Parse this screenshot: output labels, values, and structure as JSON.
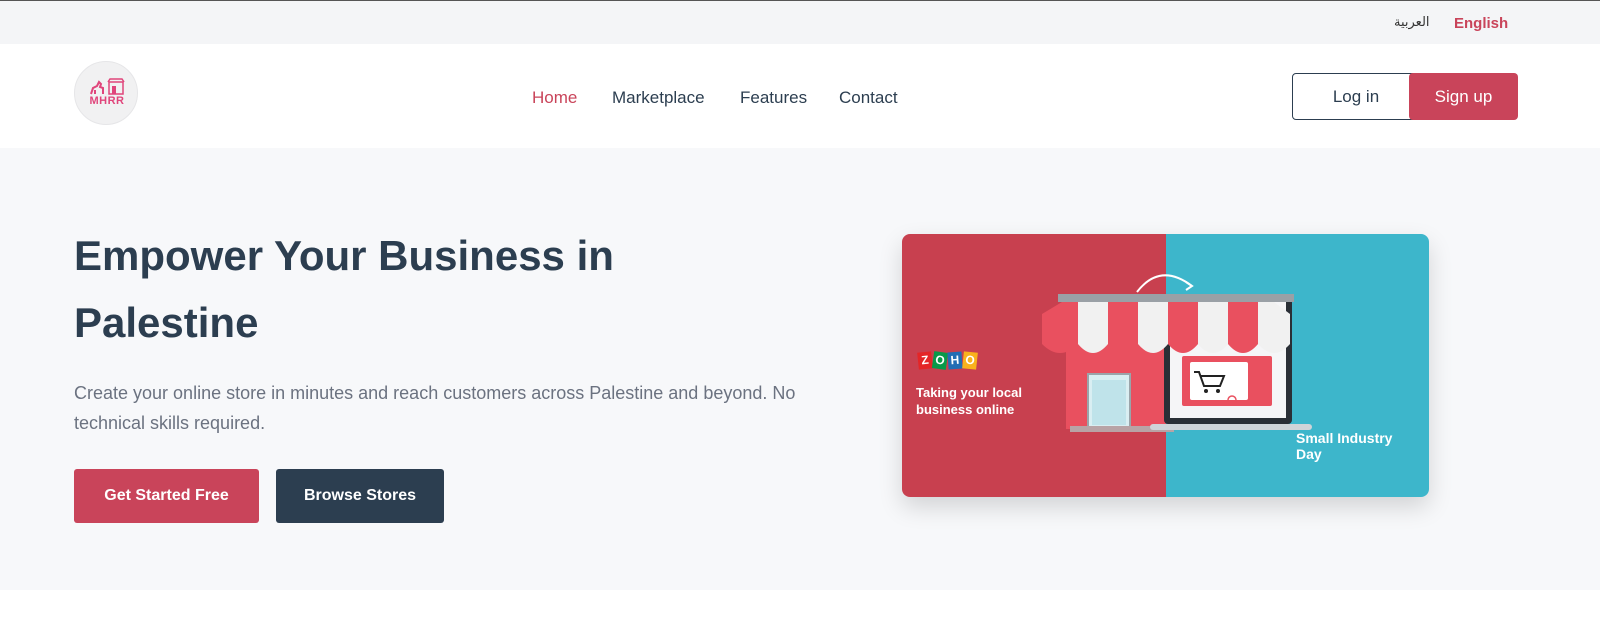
{
  "topbar": {
    "lang_arabic": "العربية",
    "lang_english": "English"
  },
  "logo": {
    "text": "MHRR"
  },
  "nav": {
    "items": [
      {
        "label": "Home",
        "active": true
      },
      {
        "label": "Marketplace",
        "active": false
      },
      {
        "label": "Features",
        "active": false
      },
      {
        "label": "Contact",
        "active": false
      }
    ],
    "login_label": "Log in",
    "signup_label": "Sign up"
  },
  "hero": {
    "title": "Empower Your Business in Palestine",
    "subtitle": "Create your online store in minutes and reach customers across Palestine and beyond. No technical skills required.",
    "cta_primary": "Get Started Free",
    "cta_secondary": "Browse Stores"
  },
  "banner": {
    "brand_letters": [
      "Z",
      "O",
      "H",
      "O"
    ],
    "left_text": "Taking your local business online",
    "right_text": "Small Industry Day"
  },
  "colors": {
    "accent": "#c9445a",
    "dark": "#2c3e50",
    "banner_red": "#c8404f",
    "banner_teal": "#3db6cb"
  }
}
